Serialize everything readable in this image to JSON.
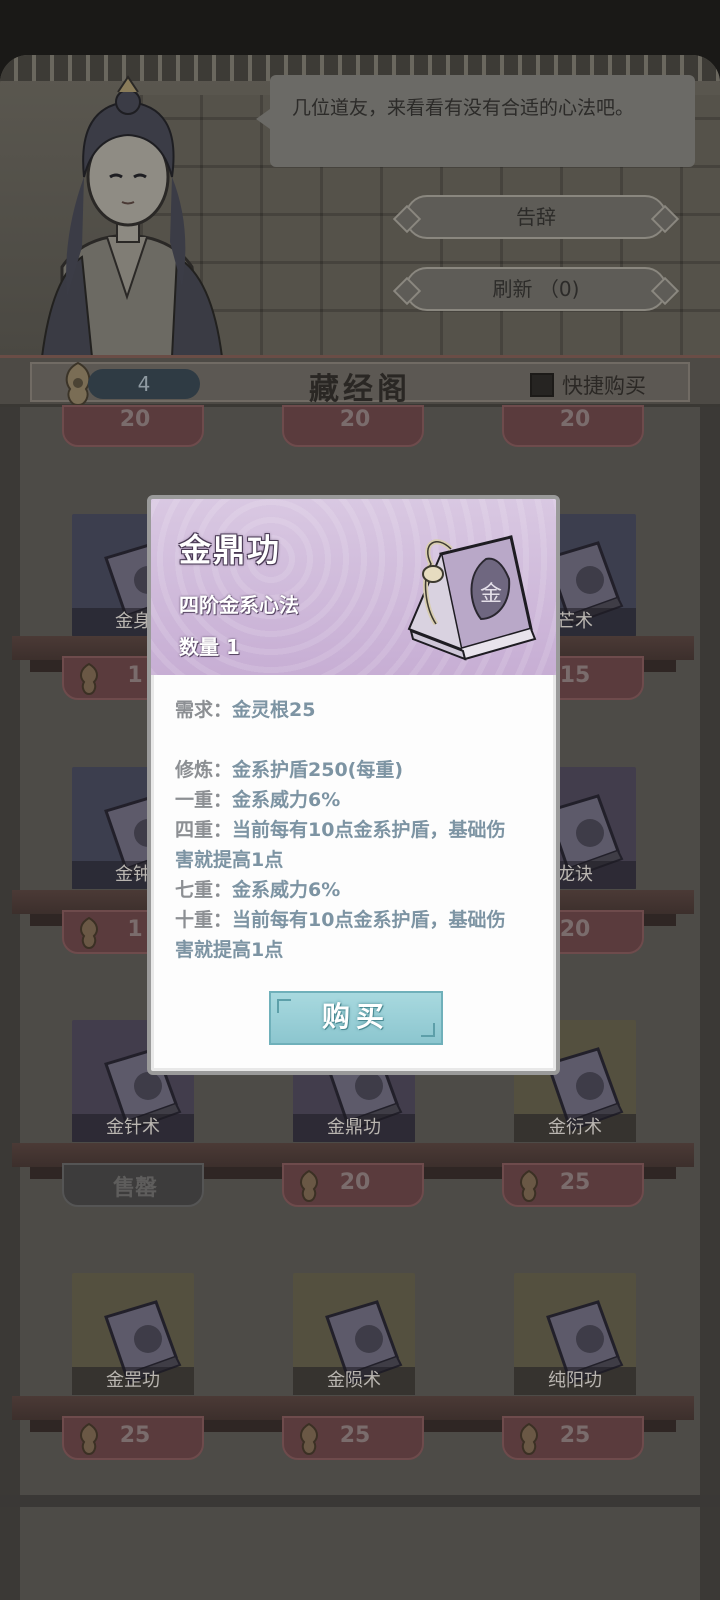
{
  "scene": {
    "dialogue": "几位道友，来看看有没有合适的心法吧。",
    "leave_button": "告辞",
    "refresh_button": "刷新 （0)"
  },
  "header": {
    "stone_count": "4",
    "title": "藏经阁",
    "quick_buy_label": "快捷购买"
  },
  "grid": {
    "row0": {
      "prices": [
        "20",
        "20",
        "20"
      ]
    },
    "row1": {
      "names": [
        "金身",
        "",
        "芒术"
      ],
      "prices": [
        "1",
        "",
        "15"
      ]
    },
    "row2": {
      "names": [
        "金钟",
        "",
        "龙诀"
      ],
      "prices": [
        "1",
        "",
        "20"
      ]
    },
    "row3": {
      "names": [
        "金针术",
        "金鼎功",
        "金衍术"
      ],
      "prices": [
        "售罄",
        "20",
        "25"
      ]
    },
    "row4": {
      "names": [
        "金罡功",
        "金陨术",
        "纯阳功"
      ],
      "prices": [
        "25",
        "25",
        "25"
      ]
    }
  },
  "modal": {
    "title": "金鼎功",
    "subtitle": "四阶金系心法",
    "quantity": "数量 1",
    "book_glyph": "金",
    "lines": [
      {
        "label": "需求：",
        "value": "金灵根25"
      },
      {
        "label": "修炼：",
        "value": "金系护盾250(每重)"
      },
      {
        "label": "一重：",
        "value": "金系威力6%"
      },
      {
        "label": "四重：",
        "value": "当前每有10点金系护盾，基础伤"
      },
      {
        "label": "",
        "value": "害就提高1点"
      },
      {
        "label": "七重：",
        "value": "金系威力6%"
      },
      {
        "label": "十重：",
        "value": "当前每有10点金系护盾，基础伤"
      },
      {
        "label": "",
        "value": "害就提高1点"
      }
    ],
    "buy_button": "购买"
  },
  "colors": {
    "modal_header": "#c7aed4",
    "buy_button": "#8cc6cf",
    "price_tag": "#5a3b3d",
    "value_text": "#7d94a3"
  }
}
